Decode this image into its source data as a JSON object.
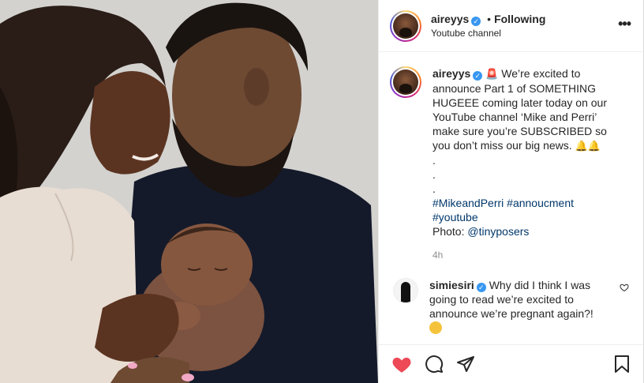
{
  "header": {
    "username": "aireyys",
    "separator": "•",
    "follow_status": "Following",
    "subtitle": "Youtube channel",
    "more_glyph": "•••"
  },
  "caption": {
    "username": "aireyys",
    "lines": [
      "We’re excited to announce Part 1 of SOMETHING HUGEEE coming later today on our YouTube channel ‘Mike and Perri’ make sure you’re SUBSCRIBED so you don’t miss our big news."
    ],
    "dots": [
      ".",
      ".",
      "."
    ],
    "hashtags": [
      "#MikeandPerri",
      "#annoucment",
      "#youtube"
    ],
    "photo_credit_label": "Photo:",
    "photo_credit_handle": "@tinyposers",
    "time_ago": "4h"
  },
  "comments": [
    {
      "username": "simiesiri",
      "text": "Why did I think I was going to read we’re excited to announce we’re pregnant again?!"
    }
  ],
  "icons": {
    "header_verified": "verified-badge-icon",
    "siren": "siren-icon",
    "bell": "bell-icon",
    "grin": "grinning-face-icon",
    "like": "heart-filled-icon",
    "comment": "comment-bubble-icon",
    "share": "paper-plane-icon",
    "save": "bookmark-icon",
    "comment_like": "heart-outline-icon"
  },
  "colors": {
    "like_red": "#ed4956",
    "verified_blue": "#3897f0",
    "hashtag_blue": "#00376b",
    "muted_gray": "#8e8e8e"
  }
}
